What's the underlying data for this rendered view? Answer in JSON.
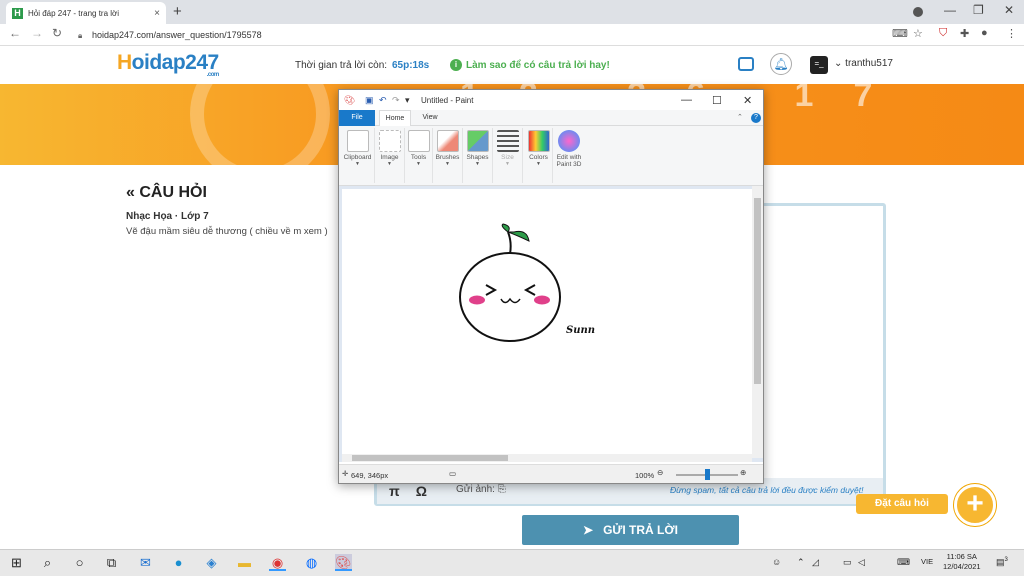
{
  "browser": {
    "tab_title": "Hỏi đáp 247 - trang tra lời",
    "tab_favicon": "H",
    "tab_close": "×",
    "new_tab": "+",
    "url": "hoidap247.com/answer_question/1795578",
    "back": "←",
    "forward": "→",
    "reload": "↻",
    "minimize": "—",
    "restore": "❐",
    "close": "✕"
  },
  "site": {
    "logo_h": "H",
    "logo_rest": "oidap247",
    "logo_com": ".com",
    "timer_label": "Thời gian trả lời còn:",
    "timer_value": "65p:18s",
    "howto": "Làm sao để có câu trả lời hay!",
    "username": "tranthu517",
    "avatar_text": "=_"
  },
  "question": {
    "title": "« CÂU HỎI",
    "subject": "Nhạc Họa · Lớp 7",
    "text": "Vẽ đậu mầm siêu dễ thương ( chiều về m xem )"
  },
  "answer": {
    "pi": "π",
    "omega": "Ω",
    "upload": "Gửi ảnh:",
    "spam_note": "Đừng spam, tất cả câu trả lời đều được kiểm duyệt!",
    "submit": "GỬI TRẢ LỜI",
    "ask": "Đặt câu hỏi",
    "ask_plus": "+"
  },
  "paint": {
    "title": "Untitled - Paint",
    "tabs": {
      "file": "File",
      "home": "Home",
      "view": "View"
    },
    "groups": [
      "Clipboard",
      "Image",
      "Tools",
      "Brushes",
      "Shapes",
      "Size",
      "Colors",
      "Edit with Paint 3D"
    ],
    "signature": "Sunn",
    "coords": "649, 346px",
    "zoom": "100%",
    "zoom_fraction": 0.5,
    "help": "?"
  },
  "taskbar": {
    "language": "VIE",
    "time": "11:06 SA",
    "date": "12/04/2021",
    "notifications": "3"
  },
  "colors": {
    "accent_blue": "#2a80c4",
    "orange": "#f8941e",
    "paint_file_tab": "#1979ca",
    "submit_btn": "#4d91b0",
    "green_leaf": "#4caf50",
    "blush": "#e0408a"
  }
}
